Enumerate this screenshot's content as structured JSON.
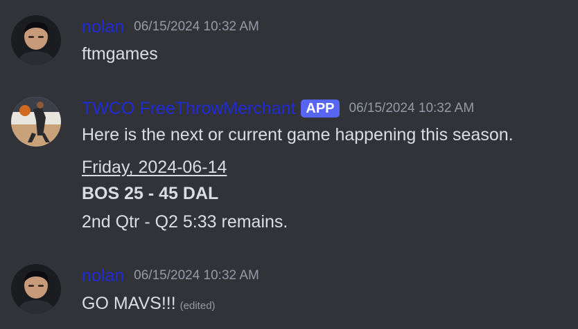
{
  "messages": [
    {
      "username": "nolan",
      "timestamp": "06/15/2024 10:32 AM",
      "text": "ftmgames"
    },
    {
      "username": "TWCO FreeThrowMerchant",
      "badge": "APP",
      "timestamp": "06/15/2024 10:32 AM",
      "text": "Here is the next or current game happening this season.",
      "date_line": "Friday, 2024-06-14",
      "score_line": "BOS 25 - 45 DAL",
      "status_line": "2nd Qtr - Q2 5:33 remains."
    },
    {
      "username": "nolan",
      "timestamp": "06/15/2024 10:32 AM",
      "text": "GO MAVS!!!",
      "edited_label": "(edited)"
    }
  ],
  "colors": {
    "background": "#313338",
    "username": "#1f2bd9",
    "badge": "#5865f2",
    "timestamp": "#949ba4",
    "text": "#dbdee1"
  }
}
